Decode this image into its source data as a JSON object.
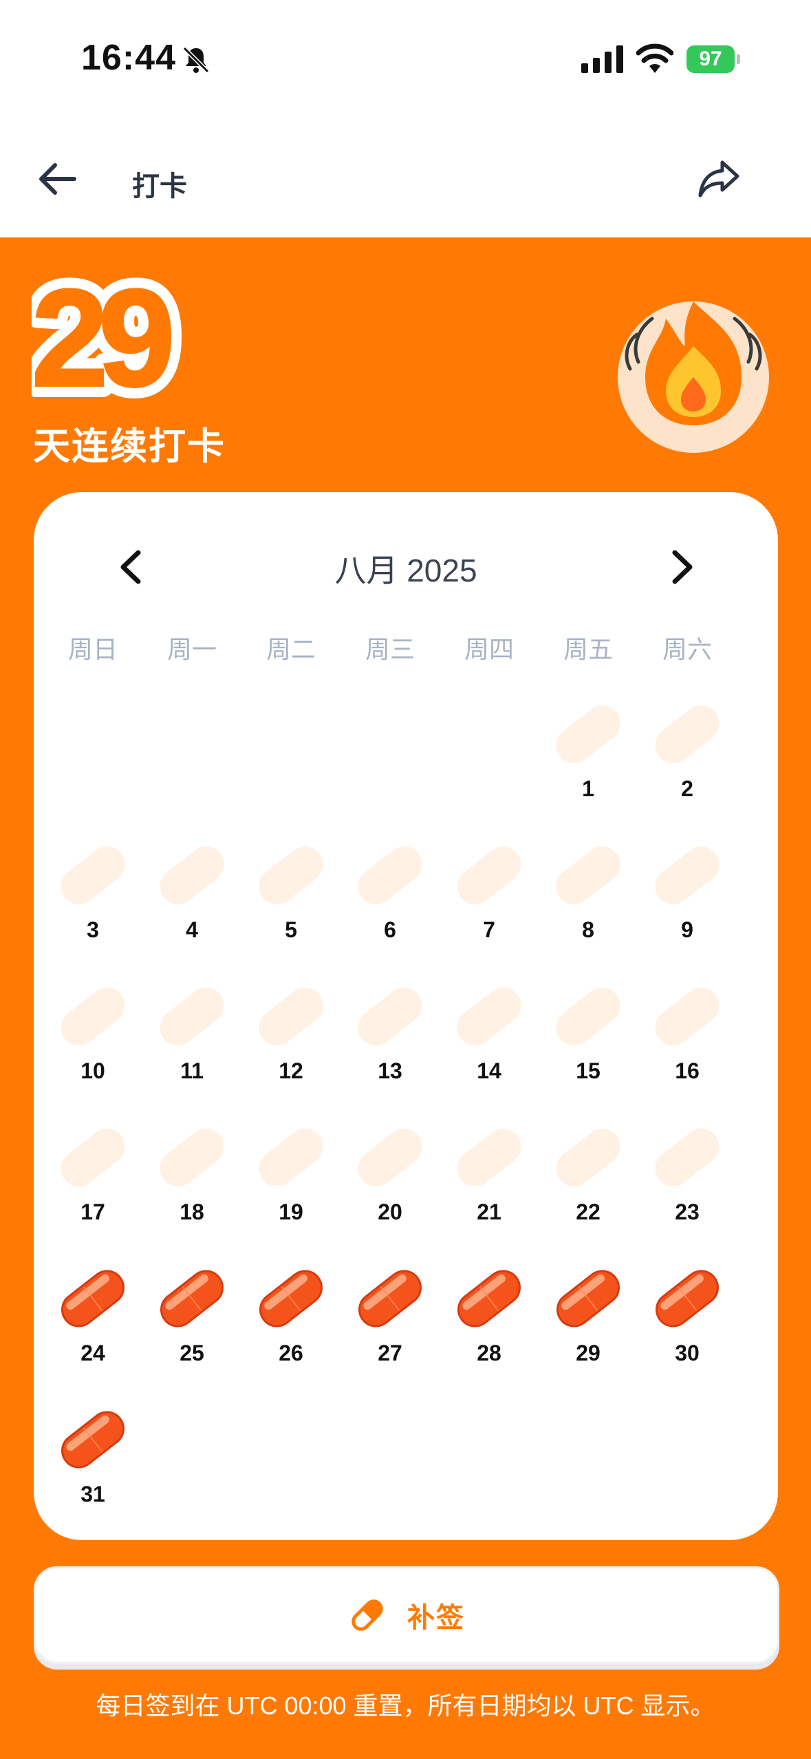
{
  "status_bar": {
    "time": "16:44",
    "battery": "97"
  },
  "header": {
    "title": "打卡"
  },
  "streak": {
    "count": "29",
    "label": "天连续打卡"
  },
  "calendar": {
    "month_title": "八月 2025",
    "weekdays": [
      "周日",
      "周一",
      "周二",
      "周三",
      "周四",
      "周五",
      "周六"
    ],
    "first_weekday_index": 5,
    "days": [
      {
        "day": "1",
        "checked": false
      },
      {
        "day": "2",
        "checked": false
      },
      {
        "day": "3",
        "checked": false
      },
      {
        "day": "4",
        "checked": false
      },
      {
        "day": "5",
        "checked": false
      },
      {
        "day": "6",
        "checked": false
      },
      {
        "day": "7",
        "checked": false
      },
      {
        "day": "8",
        "checked": false
      },
      {
        "day": "9",
        "checked": false
      },
      {
        "day": "10",
        "checked": false
      },
      {
        "day": "11",
        "checked": false
      },
      {
        "day": "12",
        "checked": false
      },
      {
        "day": "13",
        "checked": false
      },
      {
        "day": "14",
        "checked": false
      },
      {
        "day": "15",
        "checked": false
      },
      {
        "day": "16",
        "checked": false
      },
      {
        "day": "17",
        "checked": false
      },
      {
        "day": "18",
        "checked": false
      },
      {
        "day": "19",
        "checked": false
      },
      {
        "day": "20",
        "checked": false
      },
      {
        "day": "21",
        "checked": false
      },
      {
        "day": "22",
        "checked": false
      },
      {
        "day": "23",
        "checked": false
      },
      {
        "day": "24",
        "checked": true
      },
      {
        "day": "25",
        "checked": true
      },
      {
        "day": "26",
        "checked": true
      },
      {
        "day": "27",
        "checked": true
      },
      {
        "day": "28",
        "checked": true
      },
      {
        "day": "29",
        "checked": true
      },
      {
        "day": "30",
        "checked": true
      },
      {
        "day": "31",
        "checked": true
      }
    ]
  },
  "makeup_button": {
    "label": "补签",
    "icon": "pill-icon"
  },
  "footer": {
    "note": "每日签到在 UTC 00:00 重置，所有日期均以 UTC 显示。"
  },
  "colors": {
    "accent": "#ff7a05",
    "pill_empty": "#fff1e4",
    "pill_checked": "#f4541c"
  }
}
